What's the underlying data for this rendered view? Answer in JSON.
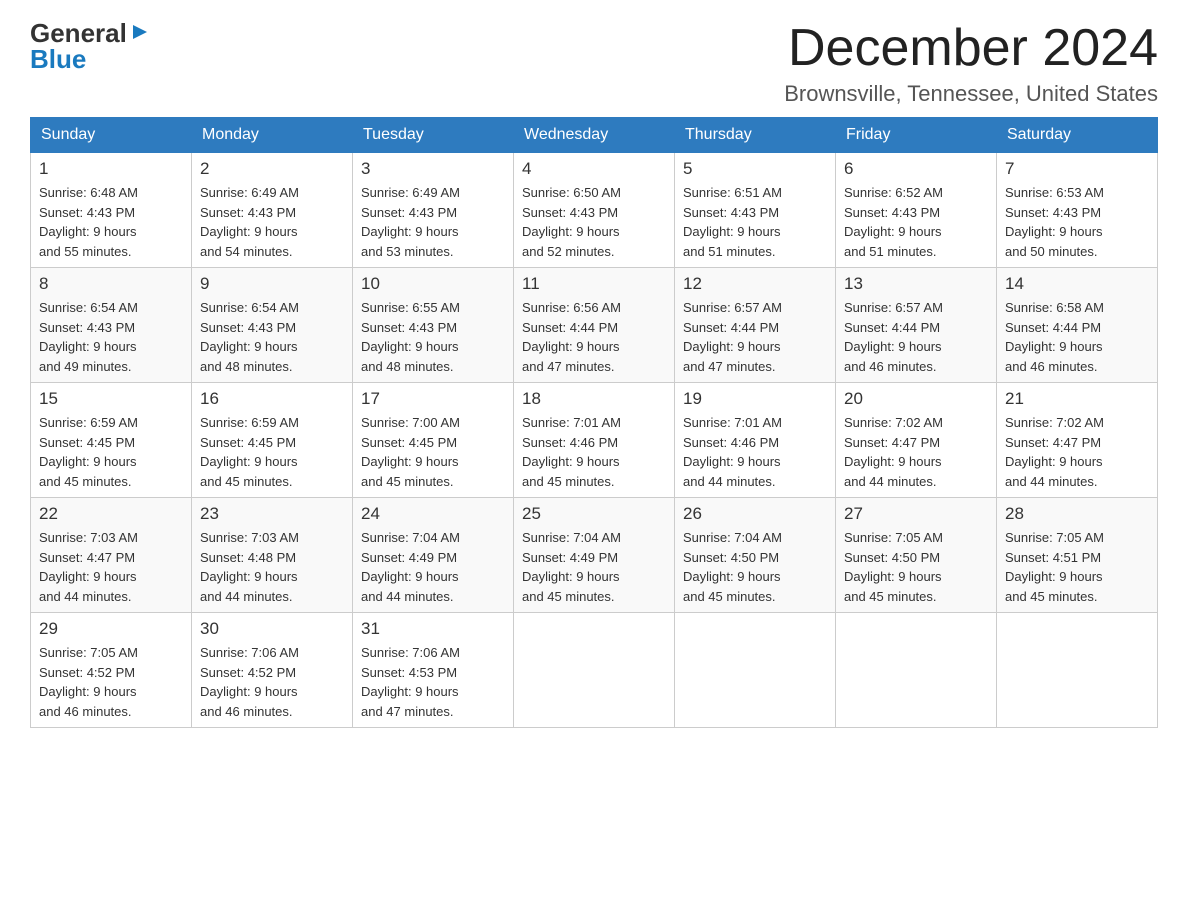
{
  "header": {
    "logo_general": "General",
    "logo_blue": "Blue",
    "month_title": "December 2024",
    "location": "Brownsville, Tennessee, United States"
  },
  "days_of_week": [
    "Sunday",
    "Monday",
    "Tuesday",
    "Wednesday",
    "Thursday",
    "Friday",
    "Saturday"
  ],
  "weeks": [
    [
      {
        "day": "1",
        "sunrise": "6:48 AM",
        "sunset": "4:43 PM",
        "daylight": "9 hours and 55 minutes."
      },
      {
        "day": "2",
        "sunrise": "6:49 AM",
        "sunset": "4:43 PM",
        "daylight": "9 hours and 54 minutes."
      },
      {
        "day": "3",
        "sunrise": "6:49 AM",
        "sunset": "4:43 PM",
        "daylight": "9 hours and 53 minutes."
      },
      {
        "day": "4",
        "sunrise": "6:50 AM",
        "sunset": "4:43 PM",
        "daylight": "9 hours and 52 minutes."
      },
      {
        "day": "5",
        "sunrise": "6:51 AM",
        "sunset": "4:43 PM",
        "daylight": "9 hours and 51 minutes."
      },
      {
        "day": "6",
        "sunrise": "6:52 AM",
        "sunset": "4:43 PM",
        "daylight": "9 hours and 51 minutes."
      },
      {
        "day": "7",
        "sunrise": "6:53 AM",
        "sunset": "4:43 PM",
        "daylight": "9 hours and 50 minutes."
      }
    ],
    [
      {
        "day": "8",
        "sunrise": "6:54 AM",
        "sunset": "4:43 PM",
        "daylight": "9 hours and 49 minutes."
      },
      {
        "day": "9",
        "sunrise": "6:54 AM",
        "sunset": "4:43 PM",
        "daylight": "9 hours and 48 minutes."
      },
      {
        "day": "10",
        "sunrise": "6:55 AM",
        "sunset": "4:43 PM",
        "daylight": "9 hours and 48 minutes."
      },
      {
        "day": "11",
        "sunrise": "6:56 AM",
        "sunset": "4:44 PM",
        "daylight": "9 hours and 47 minutes."
      },
      {
        "day": "12",
        "sunrise": "6:57 AM",
        "sunset": "4:44 PM",
        "daylight": "9 hours and 47 minutes."
      },
      {
        "day": "13",
        "sunrise": "6:57 AM",
        "sunset": "4:44 PM",
        "daylight": "9 hours and 46 minutes."
      },
      {
        "day": "14",
        "sunrise": "6:58 AM",
        "sunset": "4:44 PM",
        "daylight": "9 hours and 46 minutes."
      }
    ],
    [
      {
        "day": "15",
        "sunrise": "6:59 AM",
        "sunset": "4:45 PM",
        "daylight": "9 hours and 45 minutes."
      },
      {
        "day": "16",
        "sunrise": "6:59 AM",
        "sunset": "4:45 PM",
        "daylight": "9 hours and 45 minutes."
      },
      {
        "day": "17",
        "sunrise": "7:00 AM",
        "sunset": "4:45 PM",
        "daylight": "9 hours and 45 minutes."
      },
      {
        "day": "18",
        "sunrise": "7:01 AM",
        "sunset": "4:46 PM",
        "daylight": "9 hours and 45 minutes."
      },
      {
        "day": "19",
        "sunrise": "7:01 AM",
        "sunset": "4:46 PM",
        "daylight": "9 hours and 44 minutes."
      },
      {
        "day": "20",
        "sunrise": "7:02 AM",
        "sunset": "4:47 PM",
        "daylight": "9 hours and 44 minutes."
      },
      {
        "day": "21",
        "sunrise": "7:02 AM",
        "sunset": "4:47 PM",
        "daylight": "9 hours and 44 minutes."
      }
    ],
    [
      {
        "day": "22",
        "sunrise": "7:03 AM",
        "sunset": "4:47 PM",
        "daylight": "9 hours and 44 minutes."
      },
      {
        "day": "23",
        "sunrise": "7:03 AM",
        "sunset": "4:48 PM",
        "daylight": "9 hours and 44 minutes."
      },
      {
        "day": "24",
        "sunrise": "7:04 AM",
        "sunset": "4:49 PM",
        "daylight": "9 hours and 44 minutes."
      },
      {
        "day": "25",
        "sunrise": "7:04 AM",
        "sunset": "4:49 PM",
        "daylight": "9 hours and 45 minutes."
      },
      {
        "day": "26",
        "sunrise": "7:04 AM",
        "sunset": "4:50 PM",
        "daylight": "9 hours and 45 minutes."
      },
      {
        "day": "27",
        "sunrise": "7:05 AM",
        "sunset": "4:50 PM",
        "daylight": "9 hours and 45 minutes."
      },
      {
        "day": "28",
        "sunrise": "7:05 AM",
        "sunset": "4:51 PM",
        "daylight": "9 hours and 45 minutes."
      }
    ],
    [
      {
        "day": "29",
        "sunrise": "7:05 AM",
        "sunset": "4:52 PM",
        "daylight": "9 hours and 46 minutes."
      },
      {
        "day": "30",
        "sunrise": "7:06 AM",
        "sunset": "4:52 PM",
        "daylight": "9 hours and 46 minutes."
      },
      {
        "day": "31",
        "sunrise": "7:06 AM",
        "sunset": "4:53 PM",
        "daylight": "9 hours and 47 minutes."
      },
      null,
      null,
      null,
      null
    ]
  ],
  "labels": {
    "sunrise": "Sunrise:",
    "sunset": "Sunset:",
    "daylight": "Daylight:"
  }
}
